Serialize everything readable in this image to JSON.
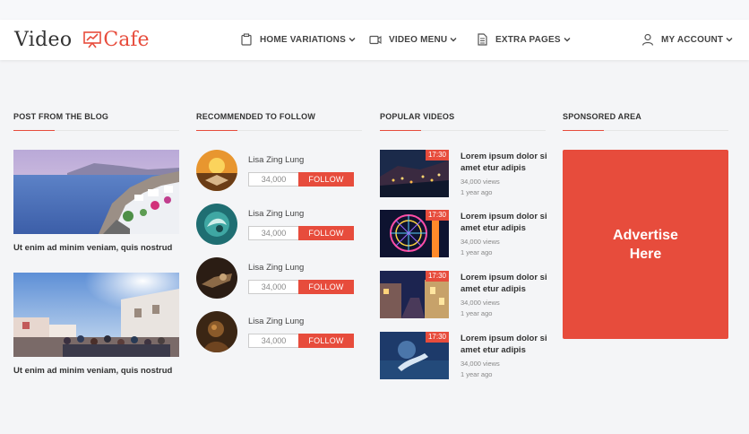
{
  "brand": {
    "video": "Video",
    "cafe": "Cafe",
    "accent": "#e74c3c"
  },
  "nav": [
    {
      "label": "HOME VARIATIONS",
      "icon": "clipboard-icon"
    },
    {
      "label": "VIDEO MENU",
      "icon": "video-camera-icon"
    },
    {
      "label": "EXTRA PAGES",
      "icon": "document-icon"
    },
    {
      "label": "MY ACCOUNT",
      "icon": "user-icon"
    }
  ],
  "sections": {
    "blog": "POST FROM THE BLOG",
    "recommended": "RECOMMENDED TO FOLLOW",
    "popular": "POPULAR VIDEOS",
    "sponsored": "SPONSORED AREA"
  },
  "blog_posts": [
    {
      "caption": "Ut enim ad minim veniam, quis nostrud"
    },
    {
      "caption": "Ut enim ad minim veniam, quis nostrud"
    }
  ],
  "recommended": [
    {
      "name": "Lisa Zing Lung",
      "count": "34,000",
      "button": "FOLLOW"
    },
    {
      "name": "Lisa Zing Lung",
      "count": "34,000",
      "button": "FOLLOW"
    },
    {
      "name": "Lisa Zing Lung",
      "count": "34,000",
      "button": "FOLLOW"
    },
    {
      "name": "Lisa Zing Lung",
      "count": "34,000",
      "button": "FOLLOW"
    }
  ],
  "popular": [
    {
      "duration": "17:30",
      "line1": "Lorem ipsum dolor si",
      "line2": "amet etur adipis",
      "views": "34,000 views",
      "ago": "1 year ago"
    },
    {
      "duration": "17:30",
      "line1": "Lorem ipsum dolor si",
      "line2": "amet etur adipis",
      "views": "34,000 views",
      "ago": "1 year ago"
    },
    {
      "duration": "17:30",
      "line1": "Lorem ipsum dolor si",
      "line2": "amet etur adipis",
      "views": "34,000 views",
      "ago": "1 year ago"
    },
    {
      "duration": "17:30",
      "line1": "Lorem ipsum dolor si",
      "line2": "amet etur adipis",
      "views": "34,000 views",
      "ago": "1 year ago"
    }
  ],
  "ad": {
    "line1": "Advertise",
    "line2": "Here"
  }
}
